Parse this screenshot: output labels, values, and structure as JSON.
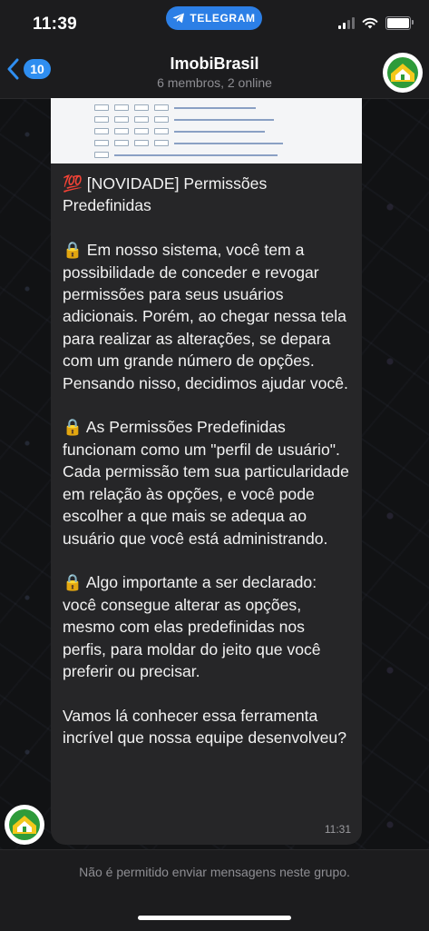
{
  "status_bar": {
    "time": "11:39",
    "app_pill": "TELEGRAM"
  },
  "header": {
    "back_count": "10",
    "title": "ImobiBrasil",
    "subtitle": "6 membros, 2 online"
  },
  "message": {
    "text": "💯 [NOVIDADE] Permissões Predefinidas\n\n🔒 Em nosso sistema, você tem a possibilidade de conceder e revogar permissões para seus usuários adicionais. Porém, ao chegar nessa tela para realizar as alterações, se depara com um grande número de opções. Pensando nisso, decidimos ajudar você.\n\n🔒 As Permissões Predefinidas funcionam como um \"perfil de usuário\". Cada permissão tem sua particularidade em relação às opções, e você pode escolher a que mais se adequa ao usuário que você está administrando.\n\n🔒 Algo importante a ser declarado: você consegue alterar as opções, mesmo com elas predefinidas nos perfis, para moldar do jeito que você preferir ou precisar.\n\nVamos lá conhecer essa ferramenta incrível que nossa equipe desenvolveu?",
    "time": "11:31"
  },
  "footer": {
    "notice": "Não é permitido enviar mensagens neste grupo."
  },
  "colors": {
    "accent": "#2f8ef0",
    "logo_green": "#2e9b3a",
    "logo_yellow": "#f3c81b",
    "bubble": "#262628"
  }
}
